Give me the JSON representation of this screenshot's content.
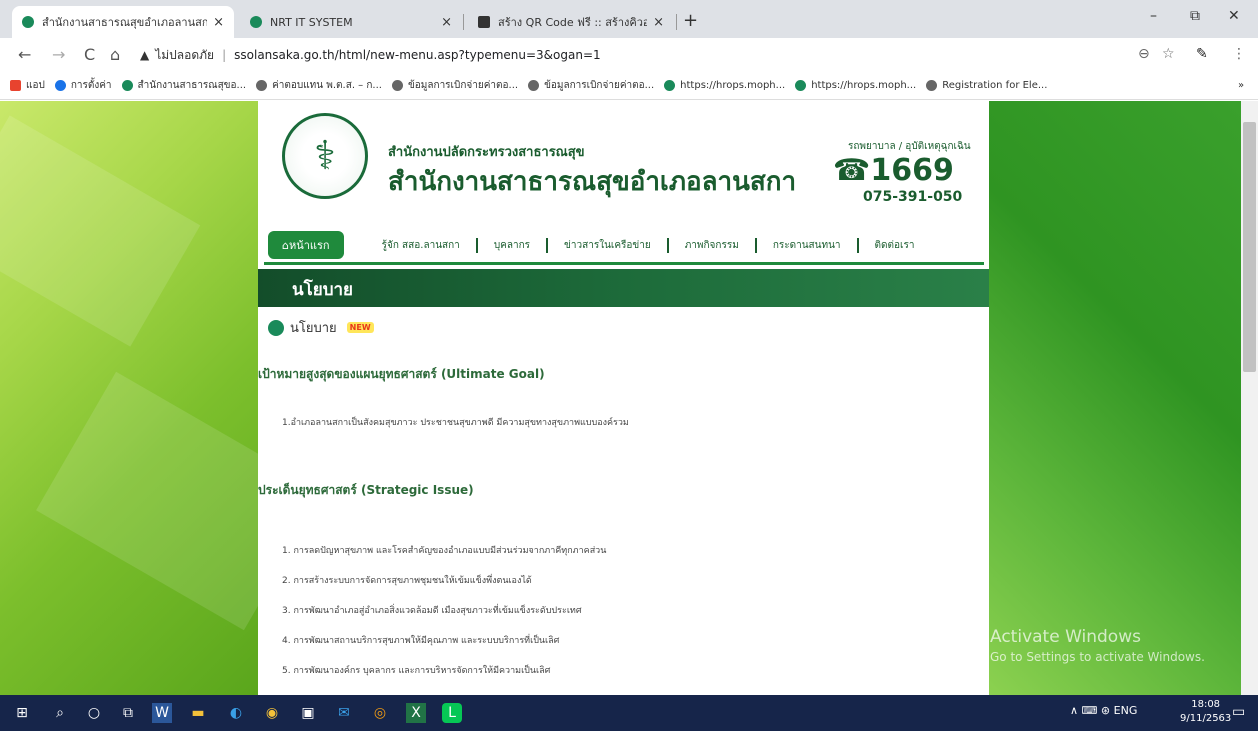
{
  "browser": {
    "tabs": [
      {
        "title": "สำนักงานสาธารณสุขอำเภอลานสกา",
        "close": "×"
      },
      {
        "title": "NRT IT SYSTEM",
        "close": "×"
      },
      {
        "title": "สร้าง QR Code ฟรี :: สร้างคิวอาร์โค้ด",
        "close": "×"
      }
    ],
    "new_tab": "+",
    "window_buttons": {
      "minimize": "–",
      "restore": "⧉",
      "close": "✕"
    },
    "nav": {
      "back": "←",
      "forward": "→",
      "reload": "C",
      "home": "⌂"
    },
    "address": {
      "warning_icon": "▲",
      "security_text": "ไม่ปลอดภัย",
      "separator": "|",
      "url": "ssolansaka.go.th/html/new-menu.asp?typemenu=3&ogan=1"
    },
    "omni_icons": {
      "zoom": "⊖",
      "star": "☆",
      "ext": "✎",
      "menu": "⋮"
    },
    "bookmarks": [
      {
        "label": "แอป",
        "color": "#e8432e"
      },
      {
        "label": "การตั้งค่า",
        "color": "#1a73e8"
      },
      {
        "label": "สำนักงานสาธารณสุขอ...",
        "color": "#1a8a5a"
      },
      {
        "label": "ค่าตอบแทน พ.ต.ส. – ก...",
        "color": "#666666"
      },
      {
        "label": "ข้อมูลการเบิกจ่ายค่าตอ...",
        "color": "#666666"
      },
      {
        "label": "ข้อมูลการเบิกจ่ายค่าตอ...",
        "color": "#666666"
      },
      {
        "label": "https://hrops.moph...",
        "color": "#1a8a5a"
      },
      {
        "label": "https://hrops.moph...",
        "color": "#1a8a5a"
      },
      {
        "label": "Registration for Ele...",
        "color": "#666666"
      }
    ],
    "bookmarks_more": "»"
  },
  "site": {
    "org_sub": "สำนักงานปลัดกระทรวงสาธารณสุข",
    "org_main": "สำนักงานสาธารณสุขอำเภอลานสกา",
    "hotline_label": "รถพยาบาล / อุบัติเหตุฉุกเฉิน",
    "hotline_number": "☎1669",
    "hotline_phone": "075-391-050",
    "menu": {
      "home": "หน้าแรก",
      "items": [
        "รู้จัก สสอ.ลานสกา",
        "บุคลากร",
        "ข่าวสารในเครือข่าย",
        "ภาพกิจกรรม",
        "กระดานสนทนา",
        "ติดต่อเรา"
      ]
    },
    "banner": "นโยบาย",
    "section_title": "นโยบาย",
    "new_badge": "NEW",
    "goal_heading": "เป้าหมายสูงสุดของแผนยุทธศาสตร์ (Ultimate Goal)",
    "goal_text": "1.อำเภอลานสกาเป็นสังคมสุขภาวะ  ประชาชนสุขภาพดี  มีความสุขทางสุขภาพแบบองค์รวม",
    "issue_heading": "ประเด็นยุทธศาสตร์ (Strategic Issue)",
    "issues": [
      "1. การลดปัญหาสุขภาพ และโรคสำคัญของอำเภอแบบมีส่วนร่วมจากภาคีทุกภาคส่วน",
      "2. การสร้างระบบการจัดการสุขภาพชุมชนให้เข้มแข็งพึ่งตนเองได้",
      "3. การพัฒนาอำเภอสู่อำเภอสิ่งแวดล้อมดี เมืองสุขภาวะที่เข้มแข็งระดับประเทศ",
      "4. การพัฒนาสถานบริการสุขภาพให้มีคุณภาพ และระบบบริการที่เป็นเลิศ",
      "5. การพัฒนาองค์กร บุคลากร และการบริหารจัดการให้มีความเป็นเลิศ"
    ]
  },
  "watermark": {
    "line1": "Activate Windows",
    "line2": "Go to Settings to activate Windows."
  },
  "taskbar": {
    "icons": [
      "⊞",
      "⌕",
      "○",
      "⧉",
      "W",
      "▬",
      "◐",
      "◉",
      "▣",
      "✉",
      "◎",
      "X",
      "L"
    ],
    "tray": "∧  ⌨  ⊛  ENG",
    "time": "18:08",
    "date": "9/11/2563",
    "notify": "▭"
  }
}
